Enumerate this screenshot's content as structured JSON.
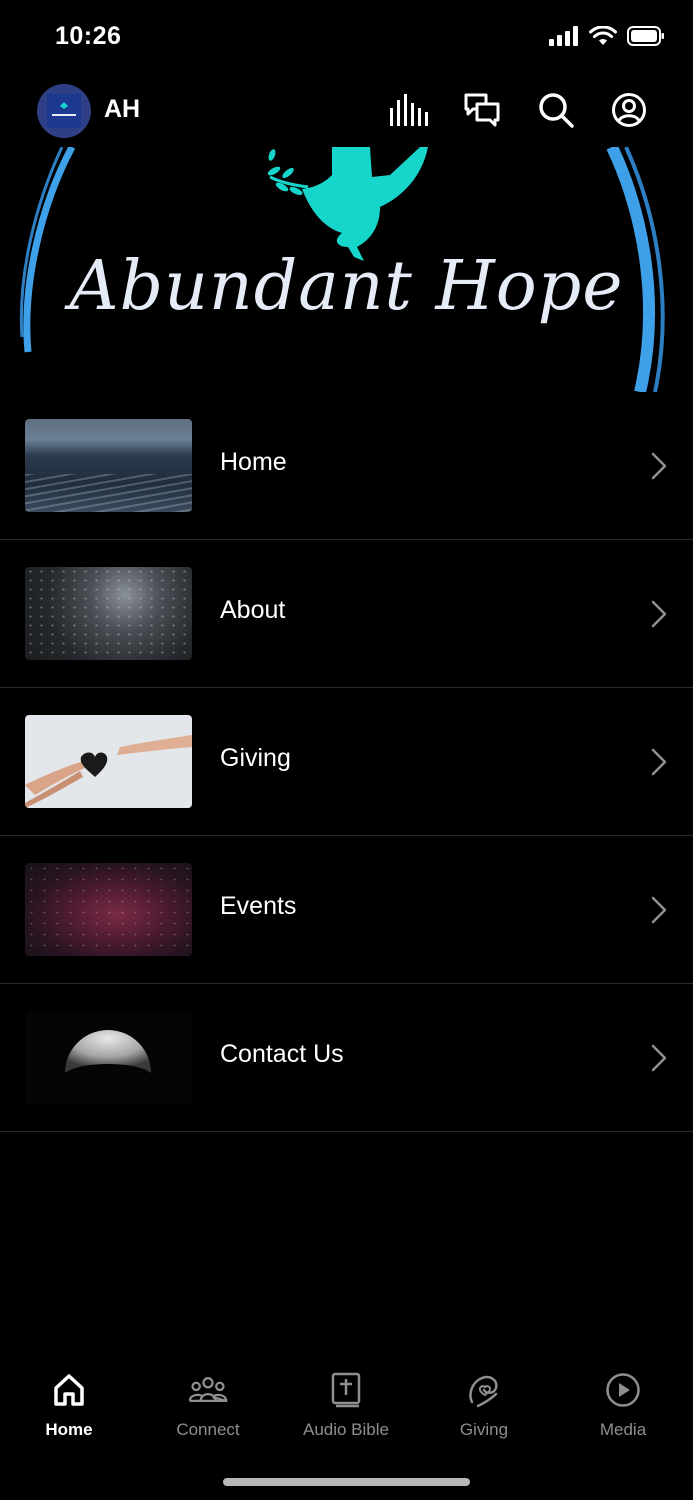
{
  "status": {
    "time": "10:26"
  },
  "header": {
    "initials": "AH"
  },
  "banner": {
    "title": "Abundant Hope"
  },
  "menu": [
    {
      "label": "Home"
    },
    {
      "label": "About"
    },
    {
      "label": "Giving"
    },
    {
      "label": "Events"
    },
    {
      "label": "Contact Us"
    }
  ],
  "tabs": [
    {
      "label": "Home",
      "icon": "home-icon",
      "active": true
    },
    {
      "label": "Connect",
      "icon": "people-icon",
      "active": false
    },
    {
      "label": "Audio Bible",
      "icon": "bible-icon",
      "active": false
    },
    {
      "label": "Giving",
      "icon": "giving-icon",
      "active": false
    },
    {
      "label": "Media",
      "icon": "play-icon",
      "active": false
    }
  ],
  "colors": {
    "accent_teal": "#16d6cc",
    "arc_blue": "#3ea0e8",
    "background": "#000000"
  }
}
